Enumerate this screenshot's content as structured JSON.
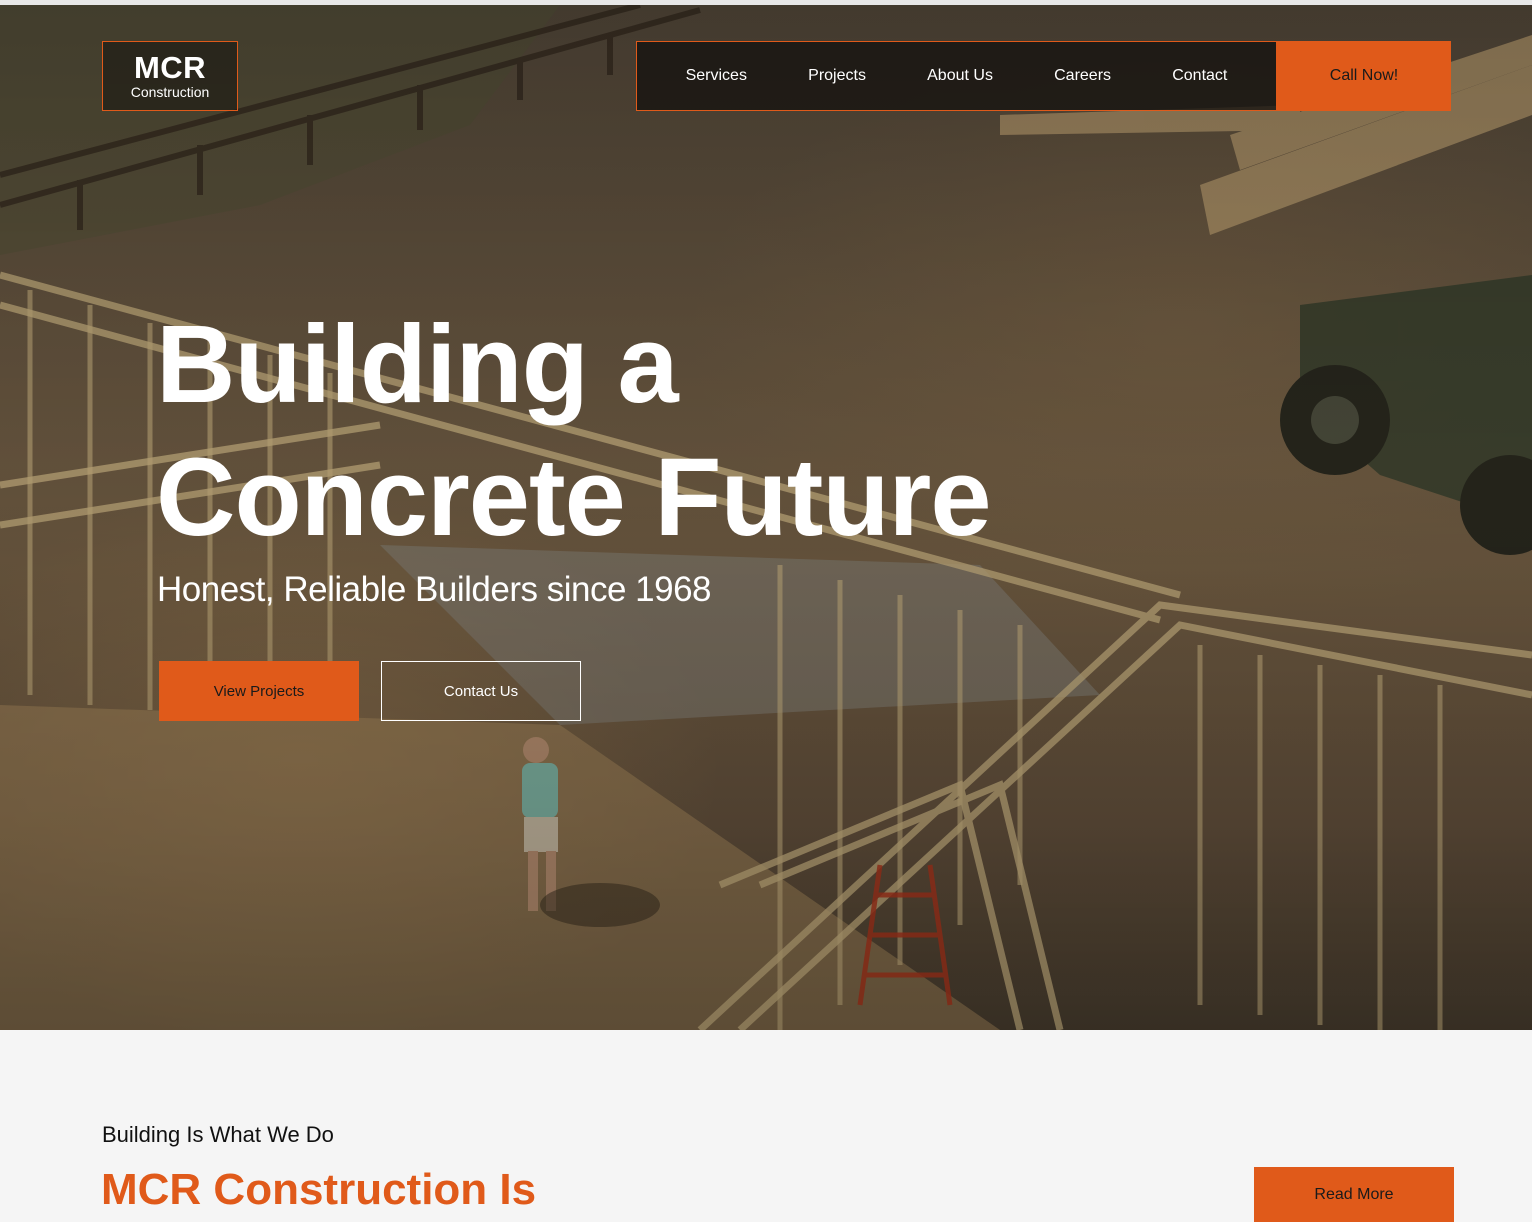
{
  "header": {
    "logo_title": "MCR",
    "logo_subtitle": "Construction",
    "nav": [
      "Services",
      "Projects",
      "About Us",
      "Careers",
      "Contact"
    ],
    "cta_label": "Call Now!"
  },
  "hero": {
    "headline_line1": "Building a",
    "headline_line2": "Concrete Future",
    "subheadline": "Honest, Reliable Builders since 1968",
    "primary_button": "View Projects",
    "secondary_button": "Contact Us"
  },
  "intro": {
    "eyebrow": "Building Is What We Do",
    "title": "MCR Construction Is",
    "button": "Read More"
  },
  "colors": {
    "accent": "#e05a1a",
    "text_light": "#ffffff",
    "section_bg": "#f5f5f5"
  }
}
